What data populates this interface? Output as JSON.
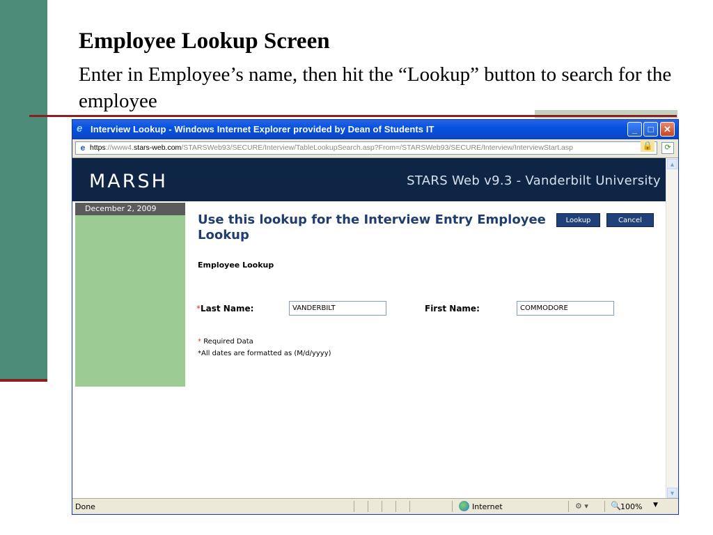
{
  "slide": {
    "title": "Employee Lookup Screen",
    "body": "Enter in Employee’s name, then hit the “Lookup” button to search for the employee"
  },
  "window": {
    "title": "Interview Lookup - Windows Internet Explorer provided by Dean of Students IT",
    "url_protocol": "https",
    "url_rest_prefix": "://www4.",
    "url_host": "stars-web.com",
    "url_path": "/STARSWeb93/SECURE/Interview/TableLookupSearch.asp?From=/STARSWeb93/SECURE/Interview/InterviewStart.asp"
  },
  "site": {
    "brand": "MARSH",
    "title": "STARS Web v9.3 - Vanderbilt University",
    "date": "December 2, 2009"
  },
  "form": {
    "heading": "Use this lookup for the Interview Entry Employee Lookup",
    "lookup_label": "Lookup",
    "cancel_label": "Cancel",
    "subheading": "Employee Lookup",
    "last_name_label": "Last Name:",
    "last_name_value": "VANDERBILT",
    "first_name_label": "First Name:",
    "first_name_value": "COMMODORE",
    "required_star": "*",
    "required_note": "Required Data",
    "dates_note": "*All dates are formatted as  (M/d/yyyy)"
  },
  "status": {
    "text": "Done",
    "zone": "Internet",
    "zoom": "100%"
  },
  "colors": {
    "slide_accent": "#4e8c7a",
    "rule": "#8b1f1f",
    "header_navy": "#0f2545",
    "side_green": "#9ccc94",
    "heading_blue": "#1f3d6d"
  }
}
